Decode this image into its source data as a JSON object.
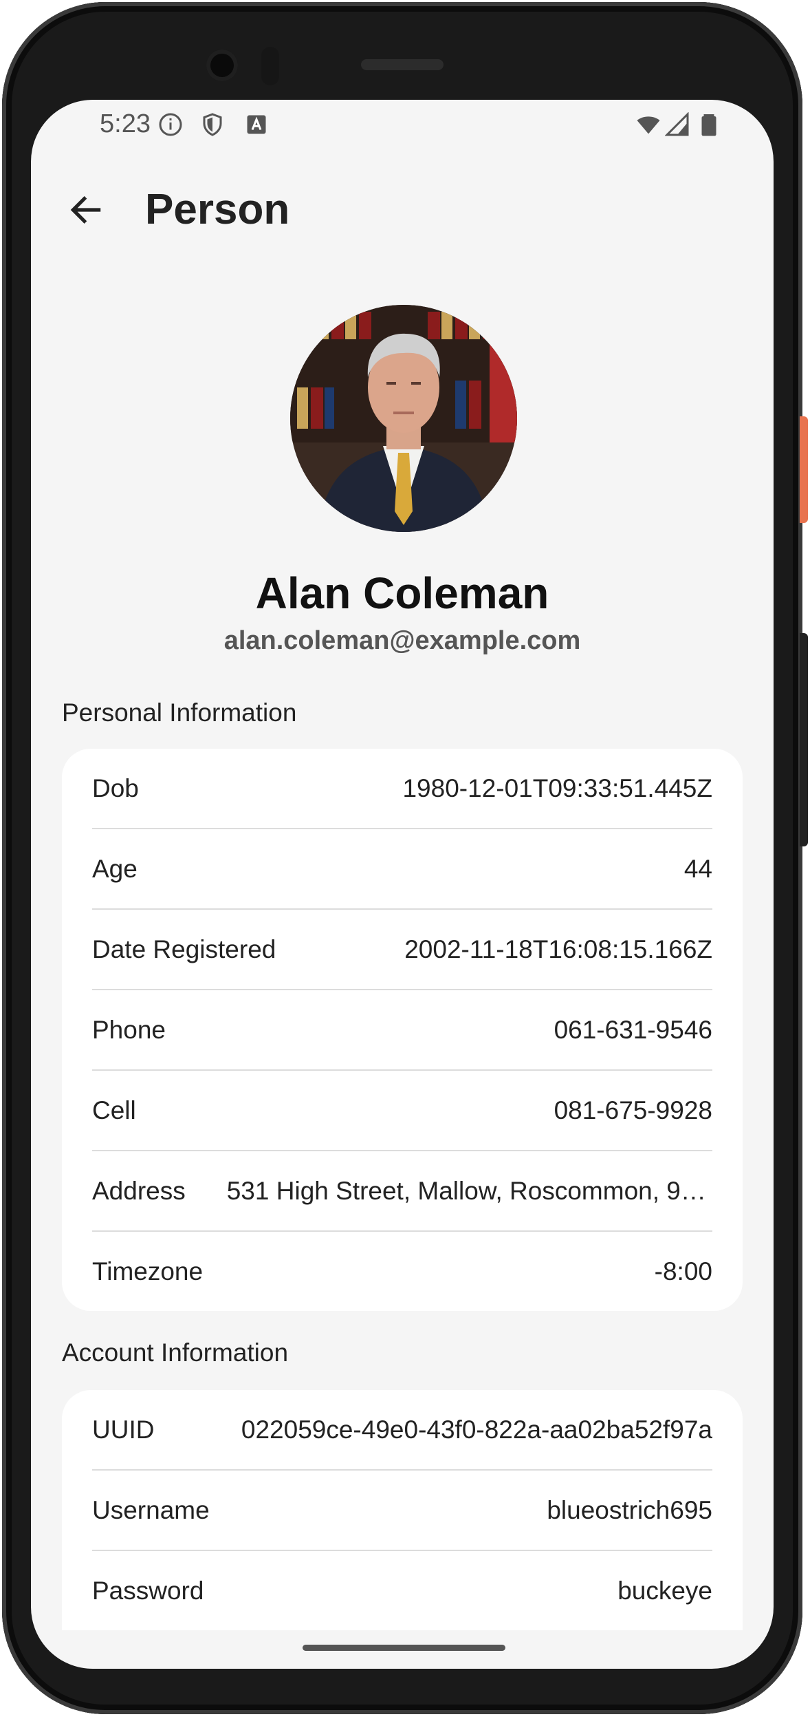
{
  "status_bar": {
    "time": "5:23",
    "icons": [
      "info-icon",
      "shield-icon",
      "text-a-icon",
      "wifi-icon",
      "signal-icon",
      "battery-icon"
    ]
  },
  "app_bar": {
    "title": "Person",
    "back_icon": "arrow-left-icon"
  },
  "profile": {
    "name": "Alan Coleman",
    "email": "alan.coleman@example.com"
  },
  "personal_information": {
    "title": "Personal Information",
    "rows": [
      {
        "label": "Dob",
        "value": "1980-12-01T09:33:51.445Z"
      },
      {
        "label": "Age",
        "value": "44"
      },
      {
        "label": "Date Registered",
        "value": "2002-11-18T16:08:15.166Z"
      },
      {
        "label": "Phone",
        "value": "061-631-9546"
      },
      {
        "label": "Cell",
        "value": "081-675-9928"
      },
      {
        "label": "Address",
        "value": "531 High Street, Mallow, Roscommon, 94..."
      },
      {
        "label": "Timezone",
        "value": "-8:00"
      }
    ]
  },
  "account_information": {
    "title": "Account Information",
    "rows": [
      {
        "label": "UUID",
        "value": "022059ce-49e0-43f0-822a-aa02ba52f97a"
      },
      {
        "label": "Username",
        "value": "blueostrich695"
      },
      {
        "label": "Password",
        "value": "buckeye"
      }
    ]
  },
  "colors": {
    "background": "#f5f5f5",
    "card": "#ffffff",
    "divider": "#dcdcdc",
    "text": "#222222",
    "muted": "#555555"
  }
}
